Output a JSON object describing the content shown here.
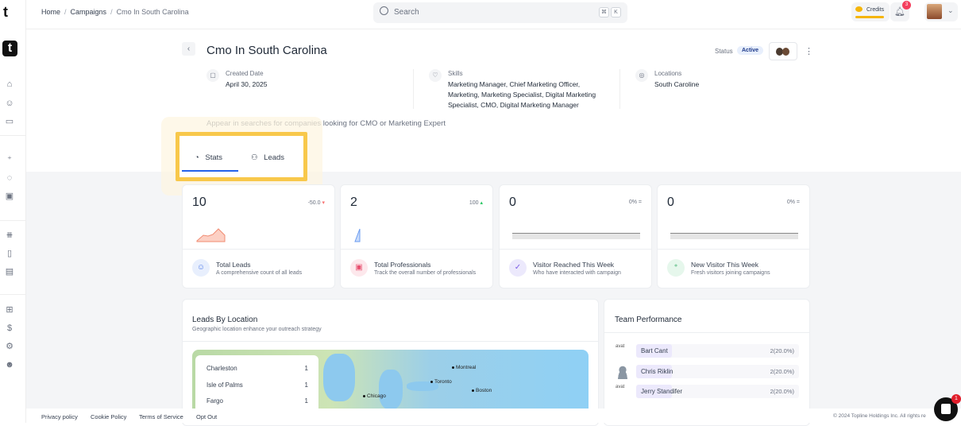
{
  "breadcrumb": [
    "Home",
    "Campaigns",
    "Cmo In South Carolina"
  ],
  "search": {
    "placeholder": "Search",
    "shortcut": [
      "⌘",
      "K"
    ]
  },
  "header": {
    "credits_label": "Credits",
    "notification_count": "3"
  },
  "campaign": {
    "title": "Cmo In South Carolina",
    "status_label": "Status",
    "status": "Active",
    "created_label": "Created Date",
    "created": "April 30, 2025",
    "skills_label": "Skills",
    "skills": "Marketing Manager, Chief Marketing Officer, Marketing, Marketing Specialist, Digital Marketing Specialist, CMO, Digital Marketing Manager",
    "locations_label": "Locations",
    "locations": "South Caroline",
    "description": "Appear in searches for companies looking for CMO or Marketing Expert"
  },
  "tabs": [
    {
      "label": "Stats",
      "active": true
    },
    {
      "label": "Leads",
      "active": false
    }
  ],
  "stats": [
    {
      "value": "10",
      "change": "-50.0 ▾",
      "trend": "down",
      "title": "Total Leads",
      "subtitle": "A comprehensive count of all leads",
      "color": "#f87171"
    },
    {
      "value": "2",
      "change": "100 ▴",
      "trend": "up",
      "title": "Total Professionals",
      "subtitle": "Track the overall number of professionals",
      "color": "#22c55e"
    },
    {
      "value": "0",
      "change": "0% =",
      "trend": "flat",
      "title": "Visitor Reached This Week",
      "subtitle": "Who have interacted with campaign",
      "color": "#6b7280"
    },
    {
      "value": "0",
      "change": "0% =",
      "trend": "flat",
      "title": "New Visitor This Week",
      "subtitle": "Fresh visitors joining campaigns",
      "color": "#6b7280"
    }
  ],
  "leads_by_location": {
    "title": "Leads By Location",
    "subtitle": "Geographic location enhance your outreach strategy",
    "rows": [
      {
        "city": "Charleston",
        "count": "1"
      },
      {
        "city": "Isle of Palms",
        "count": "1"
      },
      {
        "city": "Fargo",
        "count": "1"
      }
    ],
    "map_labels": [
      "Montreal",
      "Toronto",
      "Boston",
      "Chicago"
    ]
  },
  "team_performance": {
    "title": "Team Performance",
    "members": [
      {
        "name": "Bart Cant",
        "value": "2(20.0%)",
        "avatar_alt": "avat"
      },
      {
        "name": "Chris Riklin",
        "value": "2(20.0%)",
        "avatar_alt": ""
      },
      {
        "name": "Jerry Standifer",
        "value": "2(20.0%)",
        "avatar_alt": "avat"
      }
    ]
  },
  "footer": {
    "links": [
      "Privacy policy",
      "Cookie Policy",
      "Terms of Service",
      "Opt Out"
    ],
    "copyright": "© 2024 Topline Holdings Inc. All rights re"
  },
  "chat": {
    "badge": "1"
  }
}
